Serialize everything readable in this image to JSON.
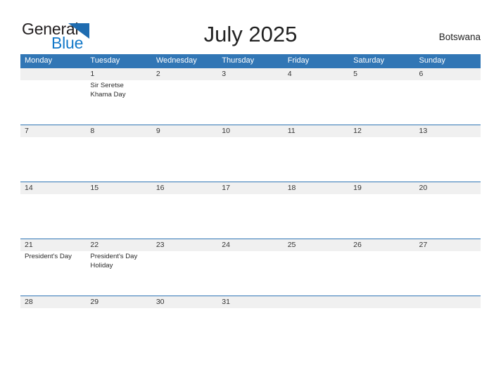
{
  "brand": {
    "name_part1": "General",
    "name_part2": "Blue",
    "triangle_icon": "triangle-flag-icon",
    "accent_blue": "#1479c9",
    "triangle_blue": "#1f6cb0"
  },
  "header": {
    "title": "July 2025",
    "region": "Botswana"
  },
  "calendar": {
    "header_color": "#3176b5",
    "band_color": "#f0f0f0",
    "weekdays": [
      "Monday",
      "Tuesday",
      "Wednesday",
      "Thursday",
      "Friday",
      "Saturday",
      "Sunday"
    ],
    "weeks": [
      {
        "dates": [
          "",
          "1",
          "2",
          "3",
          "4",
          "5",
          "6"
        ],
        "events": [
          "",
          "Sir Seretse Khama Day",
          "",
          "",
          "",
          "",
          ""
        ]
      },
      {
        "dates": [
          "7",
          "8",
          "9",
          "10",
          "11",
          "12",
          "13"
        ],
        "events": [
          "",
          "",
          "",
          "",
          "",
          "",
          ""
        ]
      },
      {
        "dates": [
          "14",
          "15",
          "16",
          "17",
          "18",
          "19",
          "20"
        ],
        "events": [
          "",
          "",
          "",
          "",
          "",
          "",
          ""
        ]
      },
      {
        "dates": [
          "21",
          "22",
          "23",
          "24",
          "25",
          "26",
          "27"
        ],
        "events": [
          "President's Day",
          "President's Day Holiday",
          "",
          "",
          "",
          "",
          ""
        ]
      },
      {
        "dates": [
          "28",
          "29",
          "30",
          "31",
          "",
          "",
          ""
        ],
        "events": [
          "",
          "",
          "",
          "",
          "",
          "",
          ""
        ]
      }
    ]
  }
}
